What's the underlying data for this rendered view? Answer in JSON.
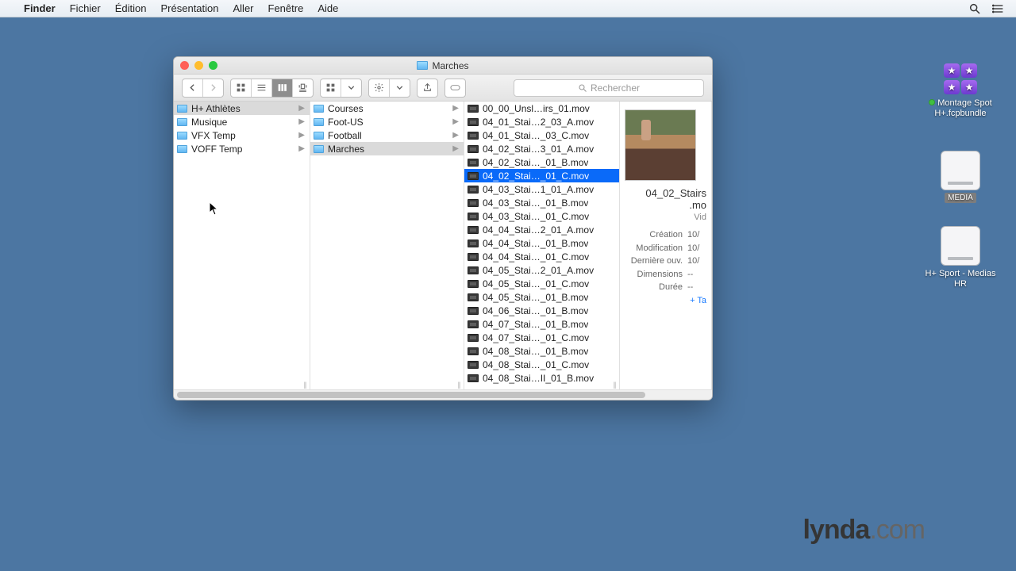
{
  "menubar": {
    "items": [
      "Finder",
      "Fichier",
      "Édition",
      "Présentation",
      "Aller",
      "Fenêtre",
      "Aide"
    ]
  },
  "window": {
    "title": "Marches",
    "search_placeholder": "Rechercher"
  },
  "columns": {
    "c0": [
      {
        "name": "H+ Athlètes",
        "selected": true
      },
      {
        "name": "Musique"
      },
      {
        "name": "VFX Temp"
      },
      {
        "name": "VOFF Temp"
      }
    ],
    "c1": [
      {
        "name": "Courses"
      },
      {
        "name": "Foot-US"
      },
      {
        "name": "Football"
      },
      {
        "name": "Marches",
        "selected": true
      }
    ],
    "c2": [
      {
        "name": "00_00_Unsl…irs_01.mov"
      },
      {
        "name": "04_01_Stai…2_03_A.mov"
      },
      {
        "name": "04_01_Stai…_03_C.mov"
      },
      {
        "name": "04_02_Stai…3_01_A.mov"
      },
      {
        "name": "04_02_Stai…_01_B.mov"
      },
      {
        "name": "04_02_Stai…_01_C.mov",
        "selected": true
      },
      {
        "name": "04_03_Stai…1_01_A.mov"
      },
      {
        "name": "04_03_Stai…_01_B.mov"
      },
      {
        "name": "04_03_Stai…_01_C.mov"
      },
      {
        "name": "04_04_Stai…2_01_A.mov"
      },
      {
        "name": "04_04_Stai…_01_B.mov"
      },
      {
        "name": "04_04_Stai…_01_C.mov"
      },
      {
        "name": "04_05_Stai…2_01_A.mov"
      },
      {
        "name": "04_05_Stai…_01_C.mov"
      },
      {
        "name": "04_05_Stai…_01_B.mov"
      },
      {
        "name": "04_06_Stai…_01_B.mov"
      },
      {
        "name": "04_07_Stai…_01_B.mov"
      },
      {
        "name": "04_07_Stai…_01_C.mov"
      },
      {
        "name": "04_08_Stai…_01_B.mov"
      },
      {
        "name": "04_08_Stai…_01_C.mov"
      },
      {
        "name": "04_08_Stai…II_01_B.mov"
      }
    ]
  },
  "preview": {
    "filename_line1": "04_02_Stairs",
    "filename_line2": ".mo",
    "meta_kind": "Vid",
    "fields": [
      {
        "k": "Création",
        "v": "10/"
      },
      {
        "k": "Modification",
        "v": "10/"
      },
      {
        "k": "Dernière ouv.",
        "v": "10/"
      },
      {
        "k": "Dimensions",
        "v": "--"
      },
      {
        "k": "Durée",
        "v": "--"
      }
    ],
    "add_tag": "+ Ta"
  },
  "desktop": {
    "fcpbundle": "Montage Spot H+.fcpbundle",
    "media": "MEDIA",
    "hplus": "H+ Sport - Medias HR"
  },
  "brand": {
    "a": "lynda",
    "b": ".com"
  }
}
